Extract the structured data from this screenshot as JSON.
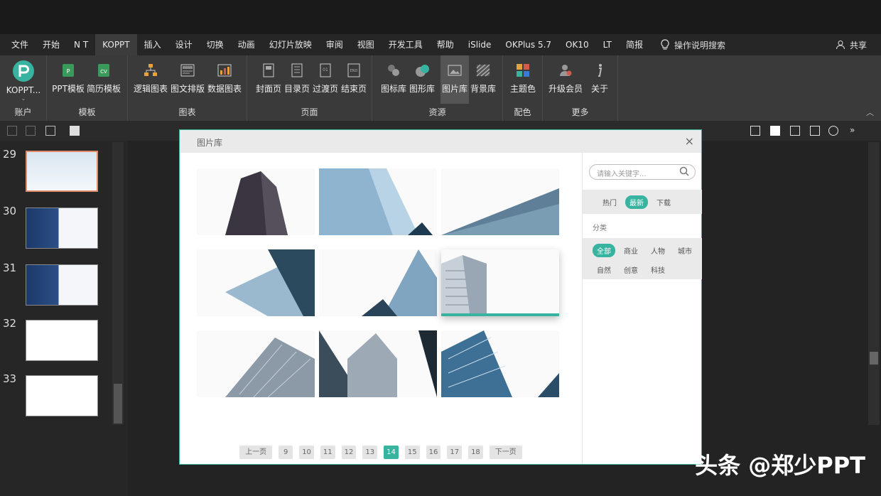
{
  "menu": {
    "tabs": [
      "文件",
      "开始",
      "N T",
      "KOPPT",
      "插入",
      "设计",
      "切换",
      "动画",
      "幻灯片放映",
      "审阅",
      "视图",
      "开发工具",
      "帮助",
      "iSlide",
      "OKPlus 5.7",
      "OK10",
      "LT",
      "简报"
    ],
    "active": "KOPPT",
    "search_label": "操作说明搜索",
    "share_label": "共享"
  },
  "ribbon": {
    "account": {
      "button": "KOPPT...",
      "group": "账户"
    },
    "templates": {
      "buttons": [
        "PPT模板",
        "简历模板"
      ],
      "group": "模板"
    },
    "charts": {
      "buttons": [
        "逻辑图表",
        "图文排版",
        "数据图表"
      ],
      "group": "图表"
    },
    "pages": {
      "buttons": [
        "封面页",
        "目录页",
        "过渡页",
        "结束页"
      ],
      "group": "页面"
    },
    "resources": {
      "buttons": [
        "图标库",
        "图形库",
        "图片库",
        "背景库"
      ],
      "group": "资源"
    },
    "colors": {
      "buttons": [
        "主题色"
      ],
      "group": "配色"
    },
    "more": {
      "buttons": [
        "升级会员",
        "关于"
      ],
      "group": "更多"
    },
    "accent": "#37b3a0"
  },
  "slides": {
    "numbers": [
      "29",
      "30",
      "31",
      "32",
      "33"
    ],
    "active": "29"
  },
  "dialog": {
    "title": "图片库",
    "close_icon": "×",
    "search_placeholder": "请输入关键字...",
    "sort": [
      "热门",
      "最新",
      "下载"
    ],
    "sort_active": "最新",
    "category_label": "分类",
    "categories_row1": [
      "全部",
      "商业",
      "人物",
      "城市"
    ],
    "categories_row2": [
      "自然",
      "创意",
      "科技"
    ],
    "category_active": "全部",
    "images": [
      "building-1",
      "building-2",
      "building-3",
      "building-4",
      "building-5",
      "building-6",
      "building-7",
      "building-8",
      "building-9"
    ],
    "selected_image": 5,
    "pager": {
      "prev": "上一页",
      "next": "下一页",
      "pages": [
        "9",
        "10",
        "11",
        "12",
        "13",
        "14",
        "15",
        "16",
        "17",
        "18"
      ],
      "current": "14"
    }
  },
  "watermark": "头条 @郑少PPT"
}
